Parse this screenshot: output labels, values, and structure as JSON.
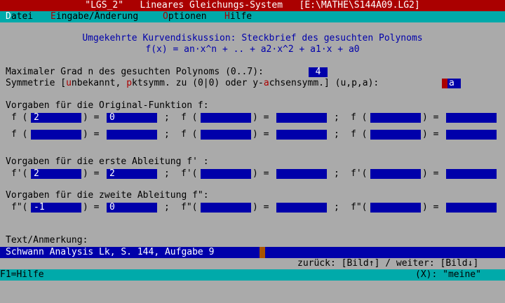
{
  "window": {
    "title": "\"LGS_2\"   Lineares Gleichungs-System   [E:\\MATHE\\S144A09.LG2]"
  },
  "menu": {
    "items": [
      {
        "hot": "D",
        "rest": "atei"
      },
      {
        "hot": "E",
        "rest": "ingabe/Änderung"
      },
      {
        "hot": "O",
        "rest": "ptionen"
      },
      {
        "hot": "H",
        "rest": "ilfe"
      }
    ]
  },
  "heading": {
    "line1": "Umgekehrte Kurvendiskussion: Steckbrief des gesuchten Polynoms",
    "line2": "f(x) = an·x^n + .. + a2·x^2 + a1·x + a0"
  },
  "degree": {
    "label": "Maximaler Grad n des gesuchten Polynoms (0..7):",
    "value": "4"
  },
  "symmetry": {
    "p1": "Symmetrie [",
    "h1": "u",
    "p2": "nbekannt, ",
    "h2": "p",
    "p3": "ktsymm. zu (0|0) oder y-",
    "h3": "a",
    "p4": "chsensymm.] (u,p,a):",
    "value": "a"
  },
  "original": {
    "label": "Vorgaben für die Original-Funktion f:",
    "prefix": "f (",
    "eq": ") =",
    "sep": ";",
    "rows": [
      [
        {
          "x": "2",
          "y": "0"
        },
        {
          "x": "",
          "y": ""
        },
        {
          "x": "",
          "y": ""
        }
      ],
      [
        {
          "x": "",
          "y": ""
        },
        {
          "x": "",
          "y": ""
        },
        {
          "x": "",
          "y": ""
        }
      ]
    ]
  },
  "first": {
    "label": "Vorgaben für die erste Ableitung f' :",
    "prefix": "f'(",
    "eq": ") =",
    "sep": ";",
    "rows": [
      [
        {
          "x": "2",
          "y": "2"
        },
        {
          "x": "",
          "y": ""
        },
        {
          "x": "",
          "y": ""
        }
      ]
    ]
  },
  "second": {
    "label": "Vorgaben für die zweite Ableitung f\":",
    "prefix": "f\"(",
    "eq": ") =",
    "sep": ";",
    "rows": [
      [
        {
          "x": "-1",
          "y": "0"
        },
        {
          "x": "",
          "y": ""
        },
        {
          "x": "",
          "y": ""
        }
      ]
    ]
  },
  "note": {
    "label": "Text/Anmerkung:",
    "value": "Schwann Analysis Lk, S. 144, Aufgabe 9"
  },
  "nav": {
    "text": "zurück: [Bild↑] / weiter: [Bild↓]"
  },
  "status": {
    "left": "F1=Hilfe",
    "right": "(X): \"meine\""
  },
  "colors": {
    "title_bg": "#aa0000",
    "menu_bg": "#00aaaa",
    "field_bg": "#0000aa",
    "background": "#aaaaaa"
  }
}
